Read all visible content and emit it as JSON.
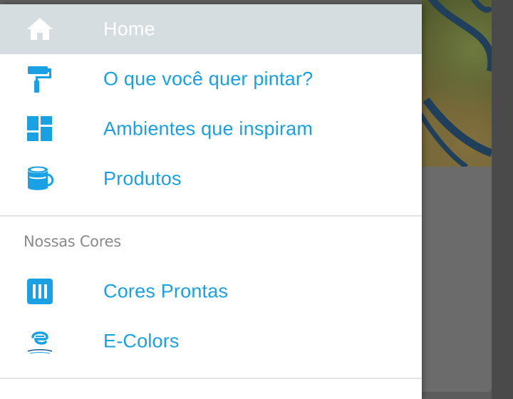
{
  "colors": {
    "accent": "#1aa1e3",
    "active_background": "#d6dde0",
    "active_text": "#ffffff",
    "section_header": "#8a8a8a",
    "divider": "#e3e3e3"
  },
  "drawer": {
    "main_items": [
      {
        "label": "Home",
        "icon": "home-icon",
        "active": true
      },
      {
        "label": "O que você quer pintar?",
        "icon": "paint-roller-icon",
        "active": false
      },
      {
        "label": "Ambientes que inspiram",
        "icon": "dashboard-grid-icon",
        "active": false
      },
      {
        "label": "Produtos",
        "icon": "paint-can-icon",
        "active": false
      }
    ],
    "section": {
      "title": "Nossas Cores",
      "items": [
        {
          "label": "Cores Prontas",
          "icon": "color-swatches-icon"
        },
        {
          "label": "E-Colors",
          "icon": "e-colors-logo-icon"
        }
      ]
    }
  }
}
